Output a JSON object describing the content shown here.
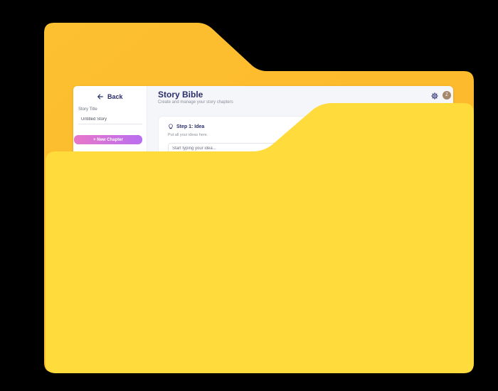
{
  "colors": {
    "folder_back": "#FDB92E",
    "folder_front": "#FFDB3B",
    "title_color": "#2B2F6B",
    "accent_gradient_start": "#E876C8",
    "accent_gradient_end": "#B96FF0"
  },
  "sidebar": {
    "back_label": "Back",
    "back_icon": "arrow-left-icon",
    "story_title_label": "Story Title",
    "story_title_value": "Untitled Story",
    "new_chapter_label": "+ New Chapter"
  },
  "header": {
    "title": "Story Bible",
    "subtitle": "Create and manage your story chapters",
    "settings_icon": "gear-icon",
    "avatar_initial": "Z"
  },
  "step": {
    "icon": "lightbulb-icon",
    "title": "Step 1: Idea",
    "description": "Put all your ideas here.",
    "input_placeholder": "Start typing your idea..."
  }
}
